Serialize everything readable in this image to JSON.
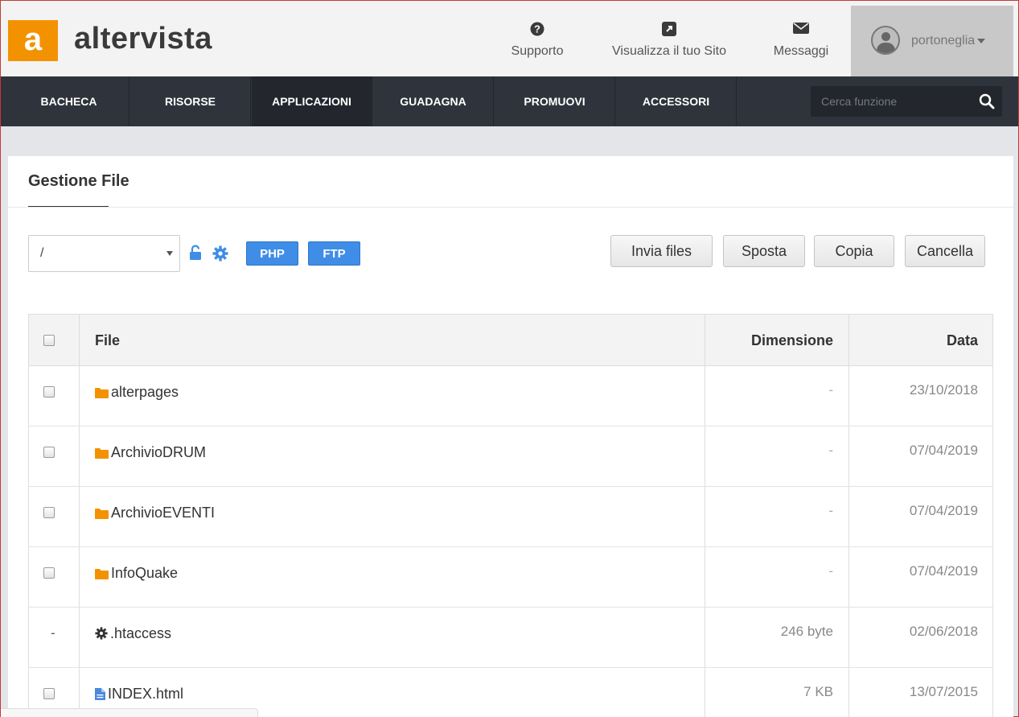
{
  "brand": {
    "logo_letter": "a",
    "name": "altervista",
    "accent": "#f39200"
  },
  "header": {
    "links": [
      {
        "label": "Supporto",
        "icon": "question-circle-icon"
      },
      {
        "label": "Visualizza il tuo Sito",
        "icon": "external-link-icon"
      },
      {
        "label": "Messaggi",
        "icon": "envelope-icon"
      }
    ],
    "user": {
      "name": "portoneglia"
    }
  },
  "nav": {
    "items": [
      {
        "label": "BACHECA"
      },
      {
        "label": "RISORSE"
      },
      {
        "label": "APPLICAZIONI",
        "active": true
      },
      {
        "label": "GUADAGNA"
      },
      {
        "label": "PROMUOVI"
      },
      {
        "label": "ACCESSORI"
      }
    ],
    "search_placeholder": "Cerca funzione"
  },
  "panel": {
    "title": "Gestione File",
    "path": "/",
    "badges": {
      "php": "PHP",
      "ftp": "FTP"
    },
    "actions": {
      "invia": "Invia files",
      "sposta": "Sposta",
      "copia": "Copia",
      "cancella": "Cancella"
    }
  },
  "table": {
    "columns": {
      "file": "File",
      "size": "Dimensione",
      "date": "Data"
    },
    "rows": [
      {
        "name": "alterpages",
        "type": "folder",
        "size": "-",
        "date": "23/10/2018"
      },
      {
        "name": "ArchivioDRUM",
        "type": "folder",
        "size": "-",
        "date": "07/04/2019"
      },
      {
        "name": "ArchivioEVENTI",
        "type": "folder",
        "size": "-",
        "date": "07/04/2019"
      },
      {
        "name": "InfoQuake",
        "type": "folder",
        "size": "-",
        "date": "07/04/2019"
      },
      {
        "name": ".htaccess",
        "type": "config",
        "check": "-",
        "size": "246 byte",
        "date": "02/06/2018"
      },
      {
        "name": "INDEX.html",
        "type": "file",
        "size": "7 KB",
        "date": "13/07/2015"
      }
    ]
  },
  "colors": {
    "navbar": "#2f333b",
    "button_blue": "#3f8de6",
    "folder": "#f39200",
    "file": "#4a89dc"
  }
}
